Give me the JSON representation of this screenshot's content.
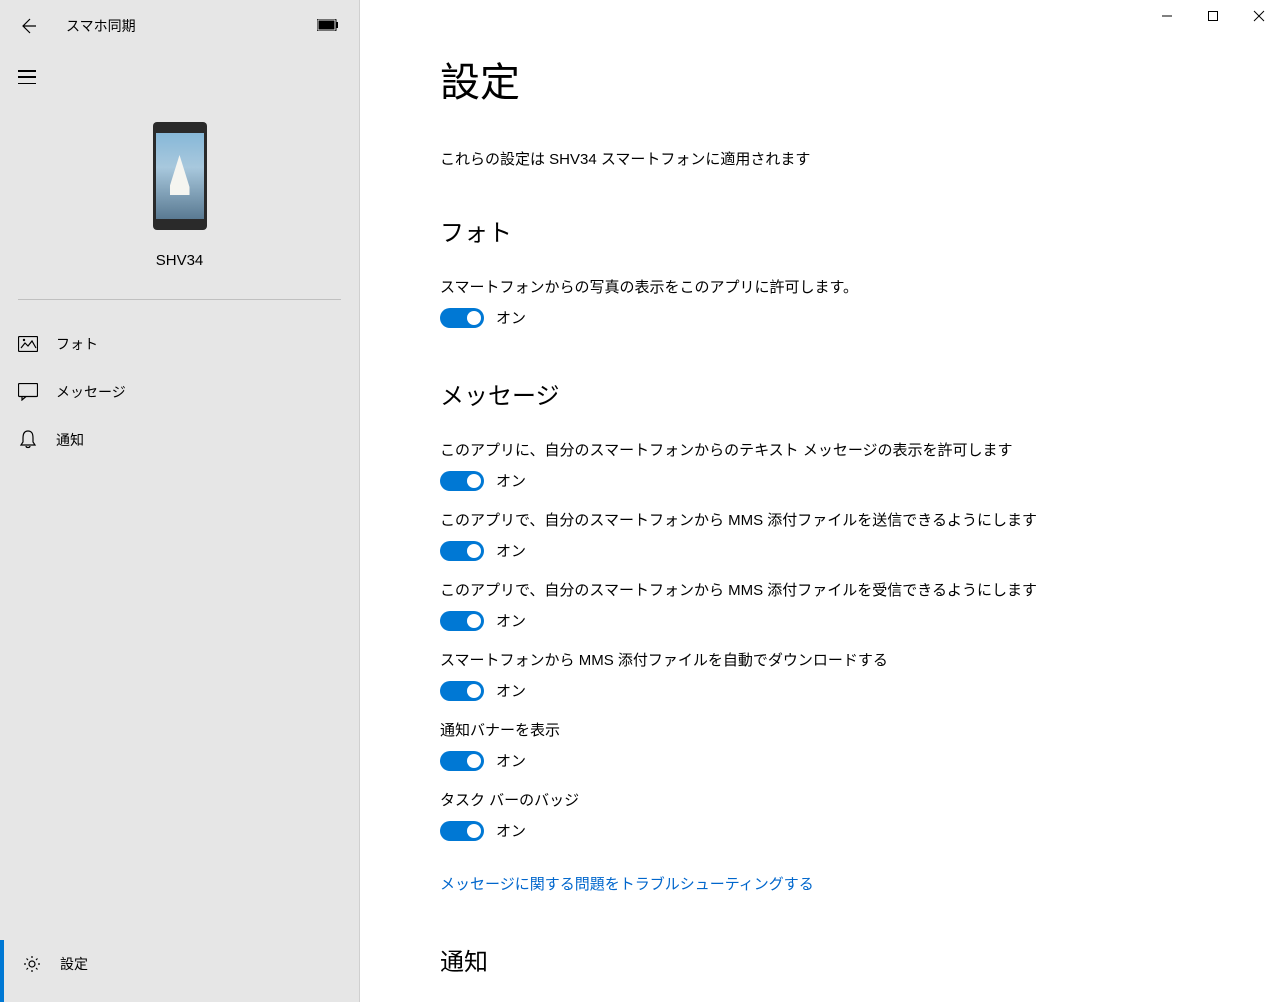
{
  "header": {
    "app_title": "スマホ同期"
  },
  "sidebar": {
    "phone_name": "SHV34",
    "nav": [
      {
        "label": "フォト",
        "icon": "photo"
      },
      {
        "label": "メッセージ",
        "icon": "message"
      },
      {
        "label": "通知",
        "icon": "bell"
      }
    ],
    "settings_label": "設定"
  },
  "main": {
    "title": "設定",
    "subtitle": "これらの設定は SHV34 スマートフォンに適用されます",
    "sections": {
      "photo": {
        "title": "フォト",
        "items": [
          {
            "label": "スマートフォンからの写真の表示をこのアプリに許可します。",
            "state": "オン"
          }
        ]
      },
      "message": {
        "title": "メッセージ",
        "items": [
          {
            "label": "このアプリに、自分のスマートフォンからのテキスト メッセージの表示を許可します",
            "state": "オン"
          },
          {
            "label": "このアプリで、自分のスマートフォンから MMS 添付ファイルを送信できるようにします",
            "state": "オン"
          },
          {
            "label": "このアプリで、自分のスマートフォンから MMS 添付ファイルを受信できるようにします",
            "state": "オン"
          },
          {
            "label": "スマートフォンから MMS 添付ファイルを自動でダウンロードする",
            "state": "オン"
          },
          {
            "label": "通知バナーを表示",
            "state": "オン"
          },
          {
            "label": "タスク バーのバッジ",
            "state": "オン"
          }
        ],
        "link": "メッセージに関する問題をトラブルシューティングする"
      },
      "notification": {
        "title": "通知"
      }
    }
  }
}
